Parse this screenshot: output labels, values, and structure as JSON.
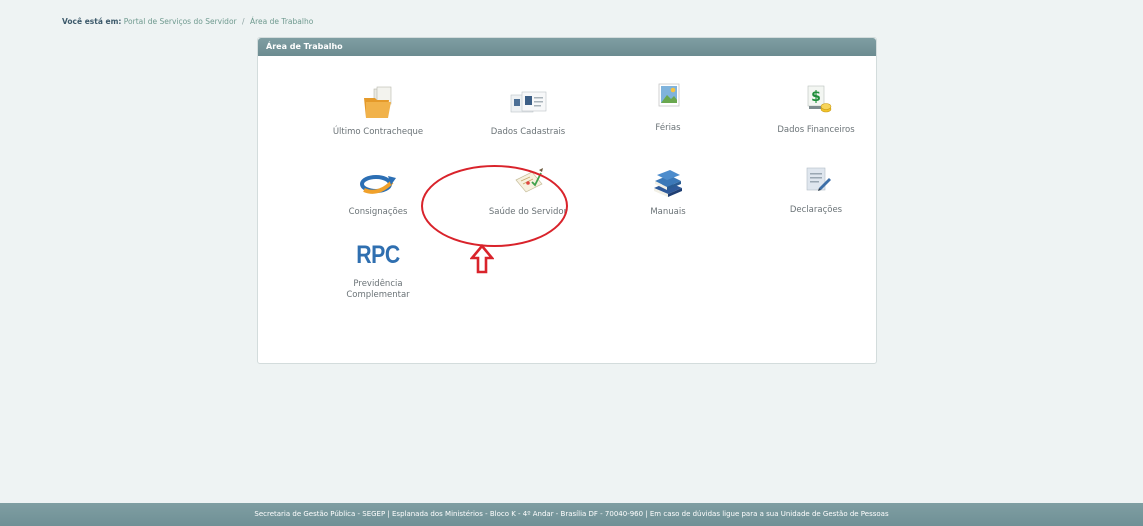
{
  "breadcrumb": {
    "label": "Você está em:",
    "items": [
      "Portal de Serviços do Servidor",
      "Área de Trabalho"
    ],
    "separator": "/"
  },
  "panel": {
    "title": "Área de Trabalho",
    "tiles": [
      {
        "label": "Último Contracheque",
        "icon": "folder-icon"
      },
      {
        "label": "Dados Cadastrais",
        "icon": "id-cards-icon"
      },
      {
        "label": "Férias",
        "icon": "vacation-picture-icon"
      },
      {
        "label": "Dados Financeiros",
        "icon": "money-icon"
      },
      {
        "label": "Consignações",
        "icon": "loan-arrow-icon"
      },
      {
        "label": "Saúde do Servidor",
        "icon": "health-form-icon"
      },
      {
        "label": "Manuais",
        "icon": "books-icon"
      },
      {
        "label": "Declarações",
        "icon": "document-pen-icon"
      },
      {
        "label": "Previdência Complementar",
        "icon": "rpc-logo",
        "icon_text": "RPC"
      }
    ]
  },
  "footer": {
    "text": "Secretaria de Gestão Pública - SEGEP | Esplanada dos Ministérios - Bloco K - 4º Andar - Brasília DF - 70040-960 | Em caso de dúvidas ligue para a sua Unidade de Gestão de Pessoas"
  },
  "colors": {
    "header_bar": "#7395a0",
    "annotation": "#d9232b",
    "background": "#eef3f3"
  }
}
